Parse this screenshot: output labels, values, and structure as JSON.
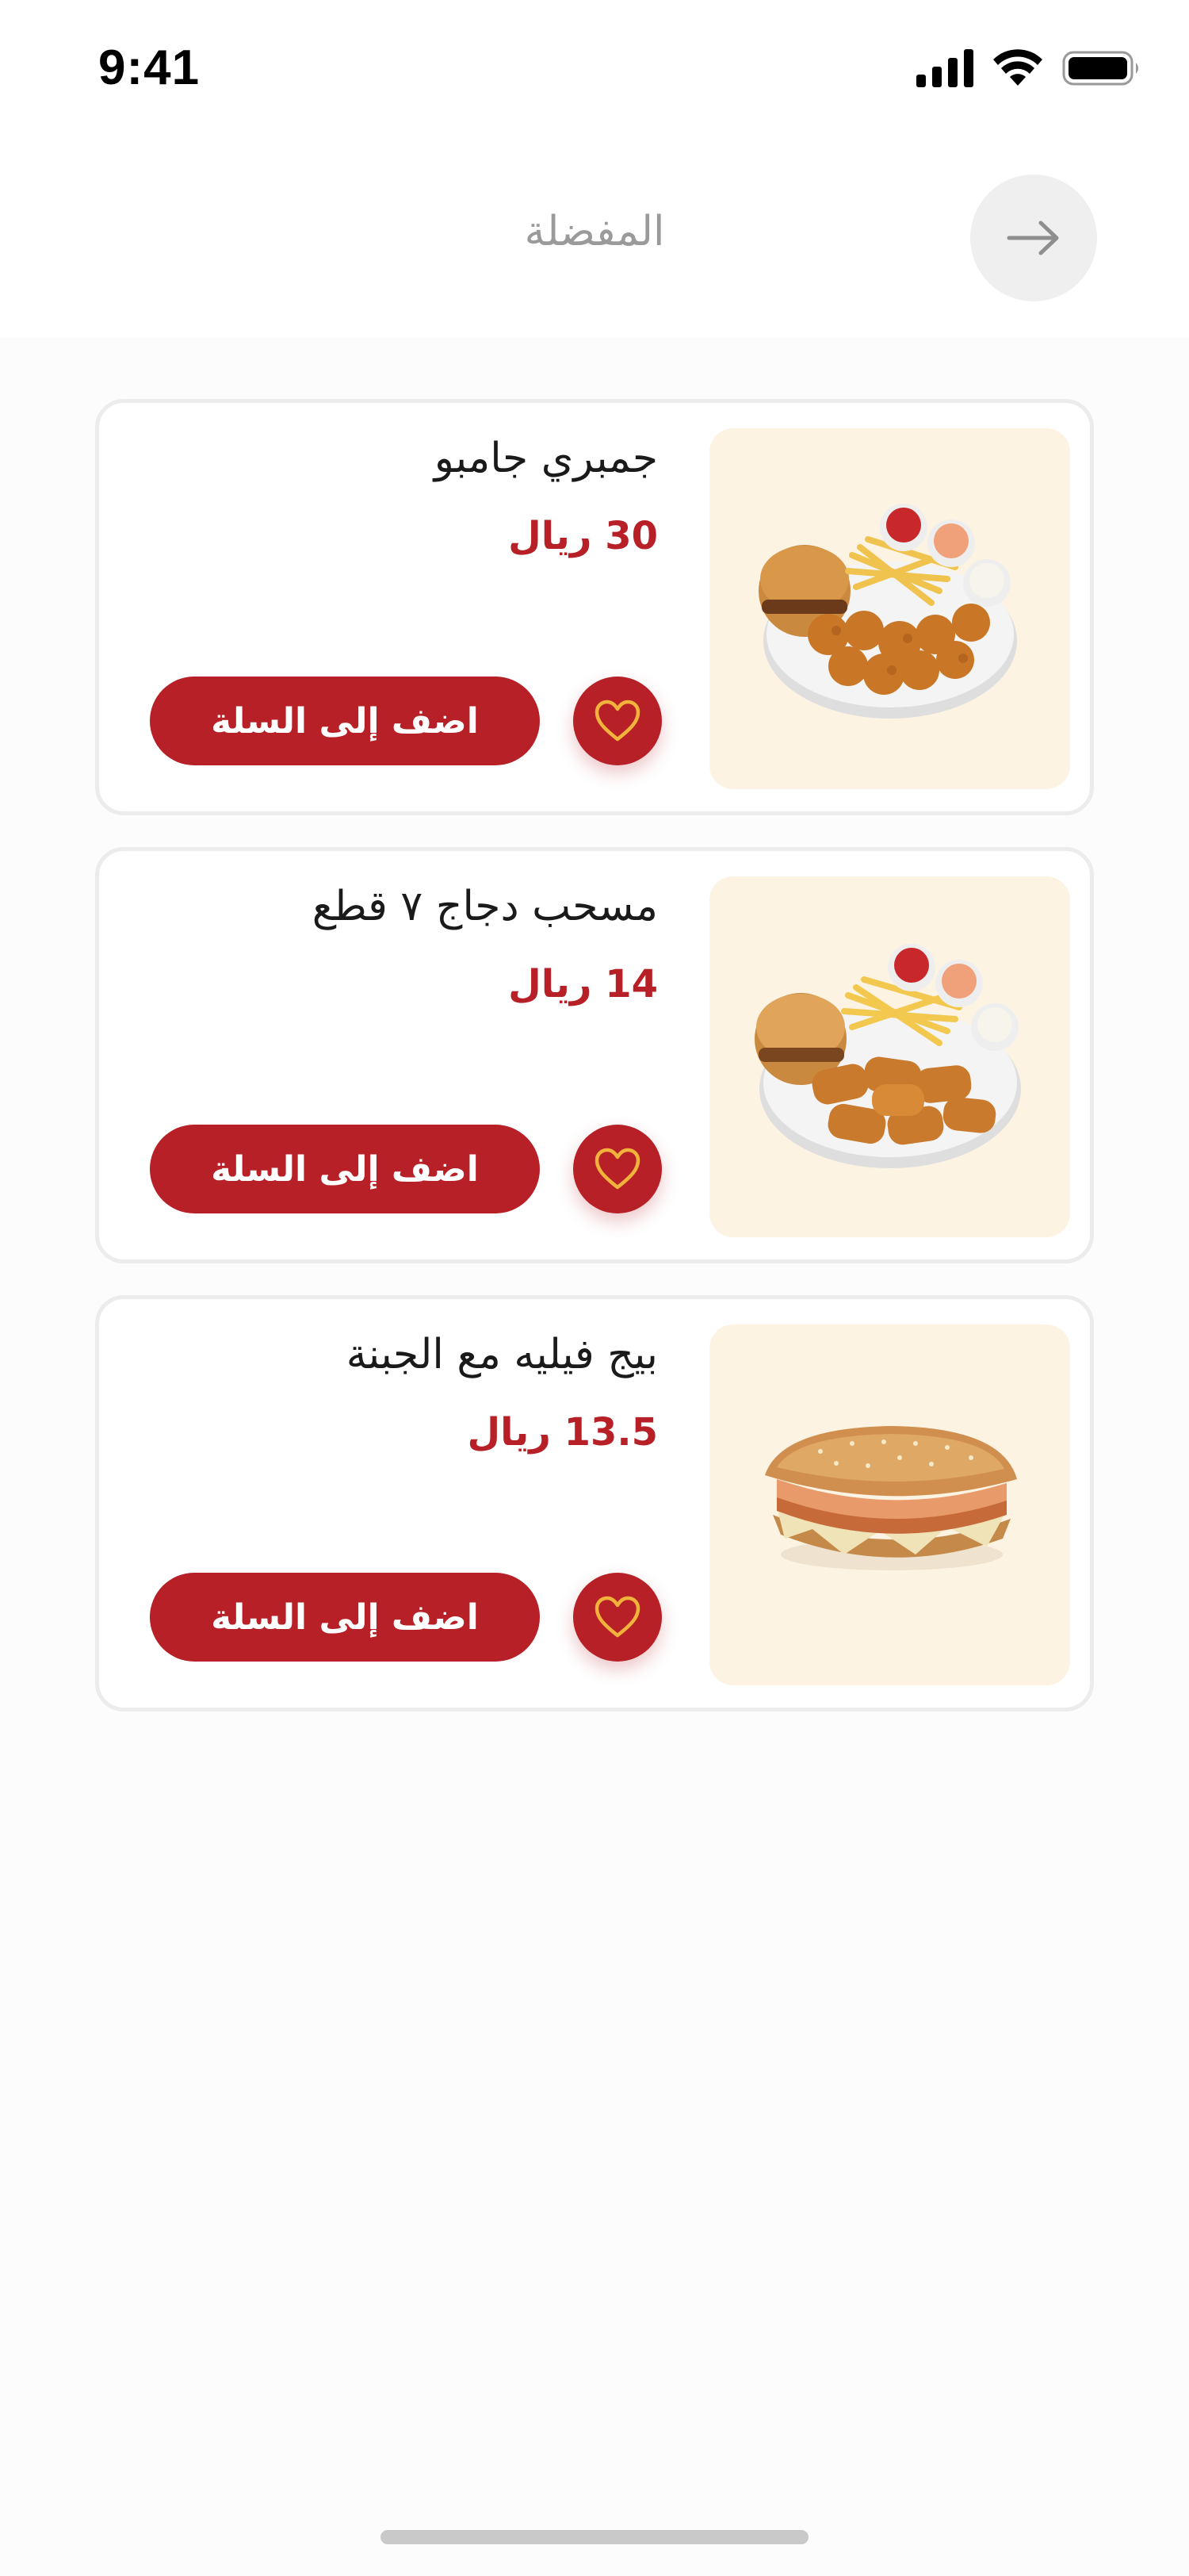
{
  "status_bar": {
    "time": "9:41"
  },
  "header": {
    "title": "المفضلة",
    "back_icon": "arrow-right-icon"
  },
  "favorites": [
    {
      "name": "جمبري جامبو",
      "price": "30 ريال",
      "add_to_cart_label": "اضف إلى السلة",
      "image": "shrimp-plate-with-burger-and-fries"
    },
    {
      "name": "مسحب دجاج ٧ قطع",
      "price": "14 ريال",
      "add_to_cart_label": "اضف إلى السلة",
      "image": "chicken-strips-plate-with-burger-and-fries"
    },
    {
      "name": "بيج فيليه مع الجبنة",
      "price": "13.5 ريال",
      "add_to_cart_label": "اضف إلى السلة",
      "image": "fillet-sandwich-with-cheese"
    }
  ],
  "colors": {
    "brand_red": "#b62026",
    "heart_outline": "#f2b33d",
    "image_bg": "#fdf3e3"
  }
}
